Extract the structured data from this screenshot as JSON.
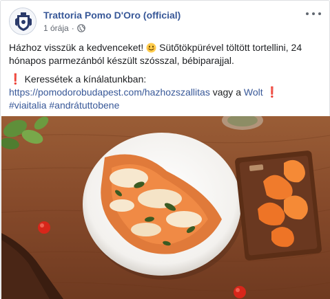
{
  "post": {
    "page_name": "Trattoria Pomo D'Oro (official)",
    "timestamp": "1 órája",
    "privacy_icon": "globe-icon",
    "line1": "Házhoz visszük a kedvenceket!",
    "line1_rest": "Sütőtökpürével töltött tortellini, 24 hónapos parmezánból készült szósszal, bébiparajjal.",
    "line2_text": "Keressétek a kínálatunkban:",
    "url": "https://pomodorobudapest.com/hazhozszallitas",
    "connector": "vagy a",
    "wolt": "Wolt",
    "hashtag1": "#viaitalia",
    "hashtag2": "#andrátuttobene"
  },
  "colors": {
    "link": "#385898",
    "text": "#1c1e21",
    "meta": "#616770",
    "exclamation": "#dd2e44"
  }
}
